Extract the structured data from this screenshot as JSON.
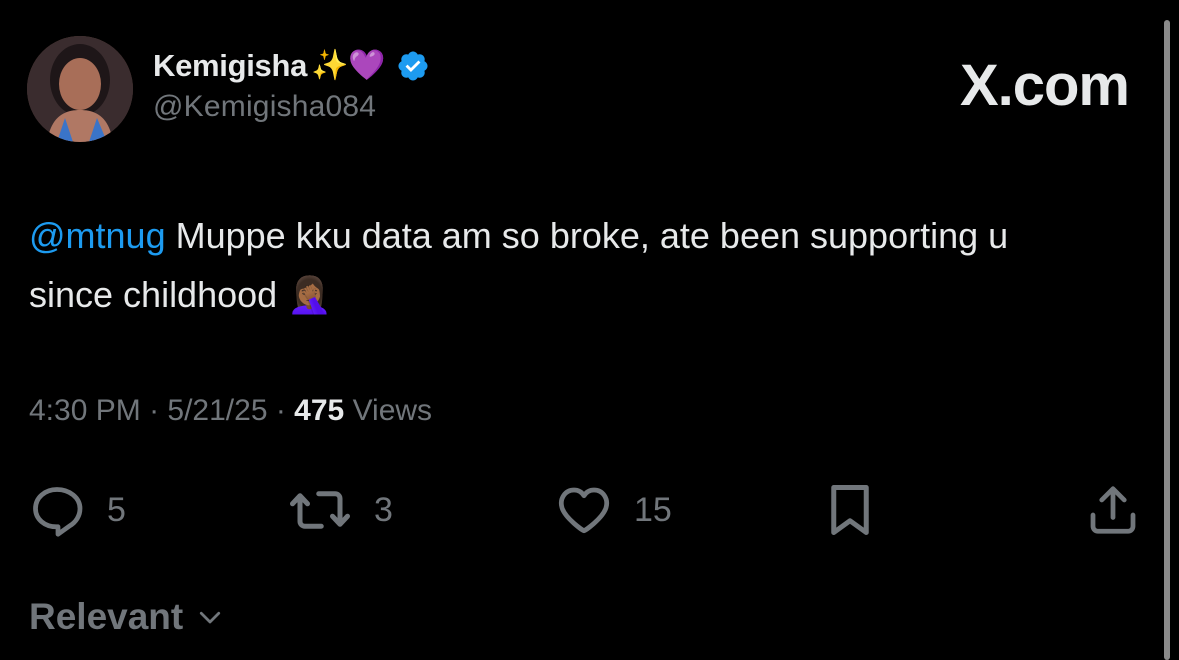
{
  "author": {
    "name": "Kemigisha",
    "name_emojis": "✨💜",
    "handle": "@Kemigisha084",
    "verified_color": "#1d9bf0"
  },
  "brand": {
    "label": "X.com"
  },
  "tweet": {
    "mention": "@mtnug",
    "text": " Muppe kku data am so broke, ate been supporting u since childhood ",
    "emoji": "🤦🏾‍♀️"
  },
  "meta": {
    "time": "4:30 PM",
    "sep1": " · ",
    "date": "5/21/25",
    "sep2": " · ",
    "views_count": "475",
    "views_label": " Views"
  },
  "actions": {
    "replies": "5",
    "reposts": "3",
    "likes": "15"
  },
  "sort": {
    "label": "Relevant"
  },
  "colors": {
    "background": "#000000",
    "text": "#e7e9ea",
    "secondary": "#71767b",
    "link": "#1d9bf0"
  }
}
